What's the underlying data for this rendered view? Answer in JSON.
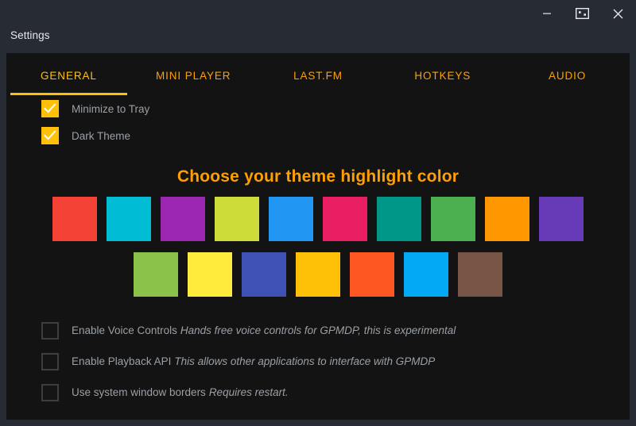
{
  "window": {
    "title": "Settings",
    "controls": [
      {
        "name": "minimize-button",
        "icon": "minimize-icon",
        "label": "Minimize"
      },
      {
        "name": "restore-button",
        "icon": "restore-icon",
        "label": "Restore"
      },
      {
        "name": "close-button",
        "icon": "close-icon",
        "label": "Close"
      }
    ]
  },
  "tabs": [
    {
      "label": "GENERAL",
      "active": true
    },
    {
      "label": "MINI PLAYER",
      "active": false
    },
    {
      "label": "LAST.FM",
      "active": false
    },
    {
      "label": "HOTKEYS",
      "active": false
    },
    {
      "label": "AUDIO",
      "active": false
    }
  ],
  "general": {
    "top_options": [
      {
        "label": "Minimize to Tray",
        "checked": true
      },
      {
        "label": "Dark Theme",
        "checked": true
      }
    ],
    "theme_heading": "Choose your theme highlight color",
    "swatch_rows": [
      [
        {
          "name": "red",
          "color": "#F44336"
        },
        {
          "name": "cyan",
          "color": "#00BCD4"
        },
        {
          "name": "purple",
          "color": "#9C27B0"
        },
        {
          "name": "lime",
          "color": "#CDDC39"
        },
        {
          "name": "blue",
          "color": "#2196F3"
        },
        {
          "name": "pink",
          "color": "#E91E63"
        },
        {
          "name": "teal",
          "color": "#009688"
        },
        {
          "name": "green",
          "color": "#4CAF50"
        },
        {
          "name": "orange",
          "color": "#FF9800"
        },
        {
          "name": "deep-purple",
          "color": "#673AB7"
        }
      ],
      [
        {
          "name": "light-green",
          "color": "#8BC34A"
        },
        {
          "name": "yellow",
          "color": "#FFEB3B"
        },
        {
          "name": "indigo",
          "color": "#3F51B5"
        },
        {
          "name": "amber",
          "color": "#FFC107"
        },
        {
          "name": "deep-orange",
          "color": "#FF5722"
        },
        {
          "name": "light-blue",
          "color": "#03A9F4"
        },
        {
          "name": "brown",
          "color": "#795548"
        }
      ]
    ],
    "bottom_options": [
      {
        "label": "Enable Voice Controls",
        "hint": "Hands free voice controls for GPMDP, this is experimental",
        "checked": false
      },
      {
        "label": "Enable Playback API",
        "hint": "This allows other applications to interface with GPMDP",
        "checked": false
      },
      {
        "label": "Use system window borders",
        "hint": "Requires restart.",
        "checked": false
      }
    ]
  },
  "colors": {
    "accent": "#FFC107",
    "accent_heading": "#FF9F06",
    "titlebar_bg": "#272B33",
    "content_bg": "#131313",
    "text_muted": "#9AA0A6"
  }
}
